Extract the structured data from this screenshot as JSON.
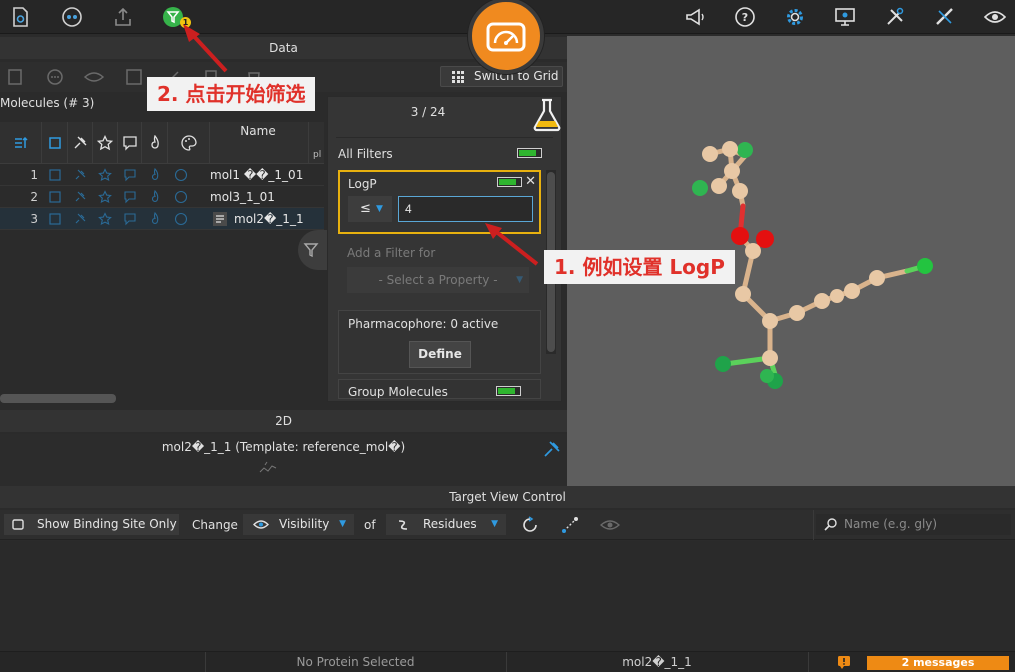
{
  "data_panel": {
    "header": "Data",
    "switch_grid_label": "Switch to Grid",
    "molecules_title": "Molecules (# 3)",
    "name_header": "Name",
    "rows": [
      {
        "num": "1",
        "name": "mol1 ��_1_01"
      },
      {
        "num": "2",
        "name": "mol3_1_01"
      },
      {
        "num": "3",
        "name": "mol2�_1_1"
      }
    ]
  },
  "filter_panel": {
    "pager": "3 / 24",
    "all_filters": "All Filters",
    "logp_title": "LogP",
    "operator": "≤",
    "value": "4",
    "add_filter_label": "Add a Filter for",
    "select_property": "- Select a Property -",
    "pharmacophore_label": "Pharmacophore: 0 active",
    "define_label": "Define",
    "group_label": "Group Molecules"
  },
  "twod": {
    "header": "2D",
    "caption": "mol2�_1_1 (Template: reference_mol�)"
  },
  "target_view": {
    "header": "Target View Control",
    "show_binding_site": "Show Binding Site Only",
    "change_label": "Change",
    "visibility_label": "Visibility",
    "of_label": "of",
    "residues_label": "Residues",
    "search_placeholder": "Name (e.g. gly)"
  },
  "status": {
    "protein": "No Protein Selected",
    "molecule": "mol2�_1_1",
    "messages": "2 messages"
  },
  "annotations": {
    "callout_1": "1. 例如设置 LogP",
    "callout_2": "2. 点击开始筛选",
    "badge": "1"
  },
  "colors": {
    "accent_blue": "#2f9ae0",
    "toggle_green": "#2fb52f",
    "highlight_yellow": "#e8b10f",
    "callout_red": "#e0312a",
    "gauge_orange": "#f08a1f",
    "messages_orange": "#ee8a14"
  }
}
